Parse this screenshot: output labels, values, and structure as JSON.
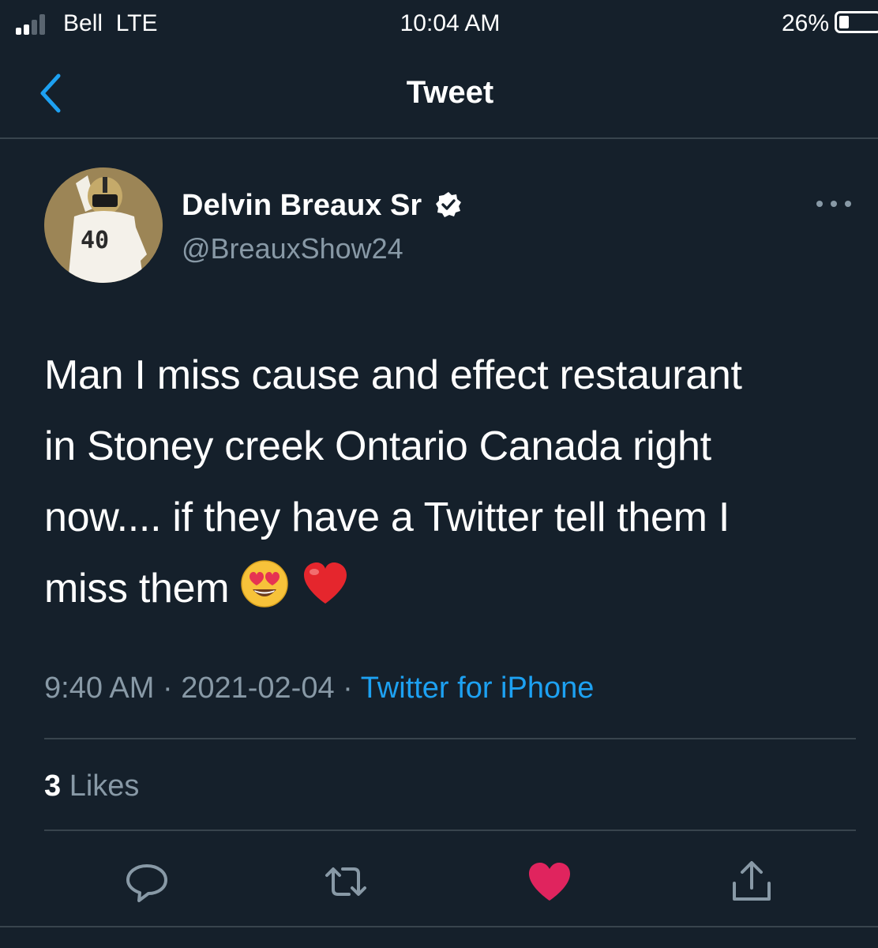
{
  "status_bar": {
    "carrier": "Bell",
    "network": "LTE",
    "time": "10:04 AM",
    "battery_percent": "26%",
    "battery_level": 0.26
  },
  "nav": {
    "title": "Tweet",
    "back_icon": "chevron-left-icon"
  },
  "tweet": {
    "author_name": "Delvin Breaux Sr",
    "author_handle": "@BreauxShow24",
    "verified": true,
    "avatar_jersey_number": "40",
    "text_lines": [
      "Man I miss cause and effect restaurant",
      "in Stoney creek Ontario Canada right",
      "now.... if they have a Twitter tell them I",
      "miss them"
    ],
    "emojis": [
      "heart-eyes-emoji",
      "red-heart-emoji"
    ],
    "time": "9:40 AM",
    "date": "2021-02-04",
    "source": "Twitter for iPhone"
  },
  "stats": {
    "likes_count": "3",
    "likes_label": "Likes"
  },
  "actions": [
    {
      "name": "reply-icon"
    },
    {
      "name": "retweet-icon"
    },
    {
      "name": "like-icon",
      "active": true
    },
    {
      "name": "share-icon"
    }
  ],
  "colors": {
    "background": "#15202b",
    "accent": "#1da1f2",
    "secondary_text": "#8899a6",
    "divider": "#38444d",
    "like": "#e0245e"
  }
}
